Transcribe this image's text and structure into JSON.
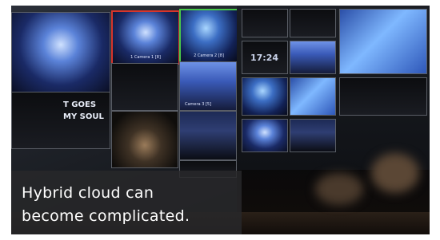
{
  "overlay_caption": {
    "line1": "Hybrid cloud can",
    "line2": "become complicated."
  },
  "monitor_left_tiles": {
    "big_text": "T GOES",
    "big_text2": "MY SOUL",
    "label_a": "1 Camera 1 [8]",
    "label_b": "2 Camera 2 [8]",
    "label_c": "Camera 3 [5]"
  },
  "monitor_right": {
    "clock": "17:24"
  },
  "colors": {
    "program_tally": "#d7352c",
    "preview_tally": "#48c84a",
    "caption_bg": "#28282a"
  }
}
